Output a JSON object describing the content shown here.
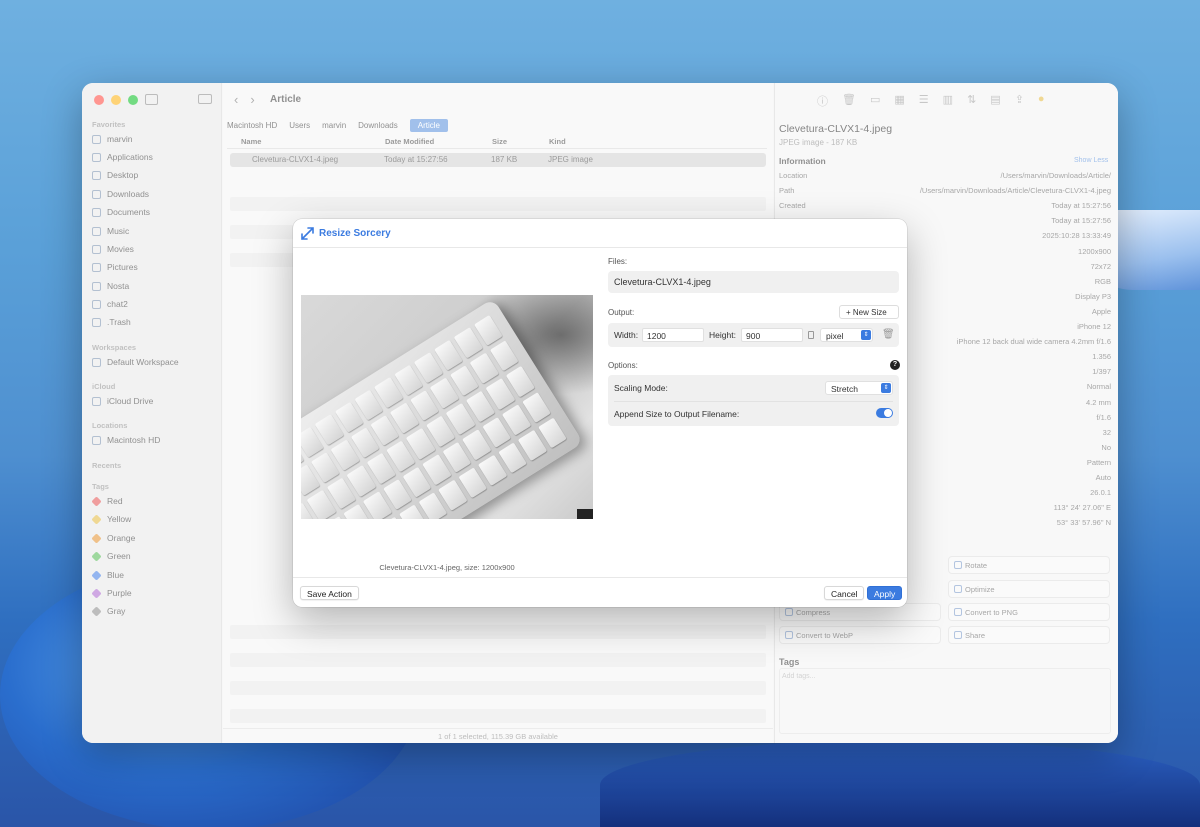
{
  "finder": {
    "window_title": "Article",
    "sidebar": {
      "favorites_label": "Favorites",
      "favorites": [
        "marvin",
        "Applications",
        "Desktop",
        "Downloads",
        "Documents",
        "Music",
        "Movies",
        "Pictures",
        "Nosta",
        "chat2",
        ".Trash"
      ],
      "workspaces_label": "Workspaces",
      "workspaces": [
        "Default Workspace"
      ],
      "icloud_label": "iCloud",
      "icloud": [
        "iCloud Drive"
      ],
      "locations_label": "Locations",
      "locations": [
        "Macintosh HD"
      ],
      "recents_label": "Recents",
      "tags_label": "Tags",
      "tags": [
        {
          "name": "Red",
          "color": "#e86a6a"
        },
        {
          "name": "Yellow",
          "color": "#e8c45a"
        },
        {
          "name": "Orange",
          "color": "#e8a04a"
        },
        {
          "name": "Green",
          "color": "#6ac46a"
        },
        {
          "name": "Blue",
          "color": "#5a8ee8"
        },
        {
          "name": "Purple",
          "color": "#b67ad4"
        },
        {
          "name": "Gray",
          "color": "#9a9a9a"
        }
      ]
    },
    "breadcrumbs": [
      "Macintosh HD",
      "Users",
      "marvin",
      "Downloads",
      "Article"
    ],
    "columns": {
      "name": "Name",
      "date": "Date Modified",
      "size": "Size",
      "kind": "Kind"
    },
    "file": {
      "name": "Clevetura-CLVX1-4.jpeg",
      "date": "Today at 15:27:56",
      "size": "187 KB",
      "kind": "JPEG image"
    },
    "status": "1 of 1 selected, 115.39 GB available",
    "inspector": {
      "title": "Clevetura-CLVX1-4.jpeg",
      "subtitle": "JPEG image - 187 KB",
      "info_label": "Information",
      "show_less": "Show Less",
      "rows": [
        {
          "k": "Location",
          "v": "/Users/marvin/Downloads/Article/"
        },
        {
          "k": "Path",
          "v": "/Users/marvin/Downloads/Article/Clevetura-CLVX1-4.jpeg"
        },
        {
          "k": "Created",
          "v": "Today at 15:27:56"
        },
        {
          "k": "",
          "v": "Today at 15:27:56"
        },
        {
          "k": "",
          "v": "2025:10:28 13:33:49"
        },
        {
          "k": "",
          "v": "1200x900"
        },
        {
          "k": "",
          "v": "72x72"
        },
        {
          "k": "",
          "v": "RGB"
        },
        {
          "k": "",
          "v": "Display P3"
        },
        {
          "k": "",
          "v": "Apple"
        },
        {
          "k": "",
          "v": "iPhone 12"
        },
        {
          "k": "",
          "v": "iPhone 12 back dual wide camera 4.2mm f/1.6"
        },
        {
          "k": "",
          "v": "1.356"
        },
        {
          "k": "",
          "v": "1/397"
        },
        {
          "k": "",
          "v": "Normal"
        },
        {
          "k": "",
          "v": "4.2 mm"
        },
        {
          "k": "",
          "v": "f/1.6"
        },
        {
          "k": "",
          "v": "32"
        },
        {
          "k": "",
          "v": "No"
        },
        {
          "k": "",
          "v": "Pattern"
        },
        {
          "k": "",
          "v": "Auto"
        },
        {
          "k": "",
          "v": "26.0.1"
        },
        {
          "k": "",
          "v": "113° 24' 27.06\" E"
        },
        {
          "k": "",
          "v": "53° 33' 57.96\" N"
        }
      ],
      "quick_actions": [
        "Rotate",
        "Optimize",
        "Compress",
        "Convert to PNG",
        "Convert to WebP",
        "Share"
      ],
      "tags_label": "Tags",
      "tags_placeholder": "Add tags..."
    }
  },
  "dialog": {
    "title": "Resize Sorcery",
    "caption": "Clevetura-CLVX1-4.jpeg, size: 1200x900",
    "files_label": "Files:",
    "file_name": "Clevetura-CLVX1-4.jpeg",
    "output_label": "Output:",
    "new_size_label": "New Size",
    "width_label": "Width:",
    "width_value": "1200",
    "height_label": "Height:",
    "height_value": "900",
    "unit": "pixel",
    "options_label": "Options:",
    "scaling_label": "Scaling Mode:",
    "scaling_value": "Stretch",
    "append_label": "Append Size to Output Filename:",
    "append_enabled": true,
    "save_action": "Save Action",
    "cancel": "Cancel",
    "apply": "Apply",
    "accent": "#3b7be0"
  }
}
